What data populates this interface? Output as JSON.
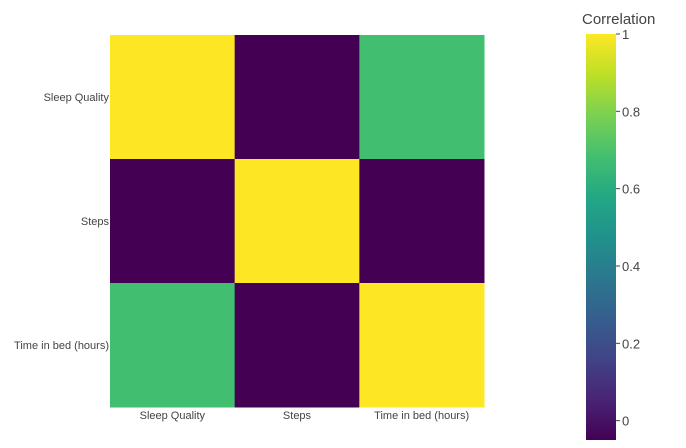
{
  "chart_data": {
    "type": "heatmap",
    "x_categories": [
      "Sleep Quality",
      "Steps",
      "Time in bed (hours)"
    ],
    "y_categories": [
      "Sleep Quality",
      "Steps",
      "Time in bed (hours)"
    ],
    "values": [
      [
        1.0,
        -0.05,
        0.68
      ],
      [
        -0.05,
        1.0,
        -0.05
      ],
      [
        0.68,
        -0.05,
        1.0
      ]
    ],
    "colorscale": "viridis",
    "colorbar": {
      "title": "Correlation",
      "range": [
        -0.05,
        1.0
      ],
      "ticks": [
        0,
        0.2,
        0.4,
        0.6,
        0.8,
        1
      ],
      "tick_labels": [
        "0",
        "0.2",
        "0.4",
        "0.6",
        "0.8",
        "1"
      ]
    }
  }
}
